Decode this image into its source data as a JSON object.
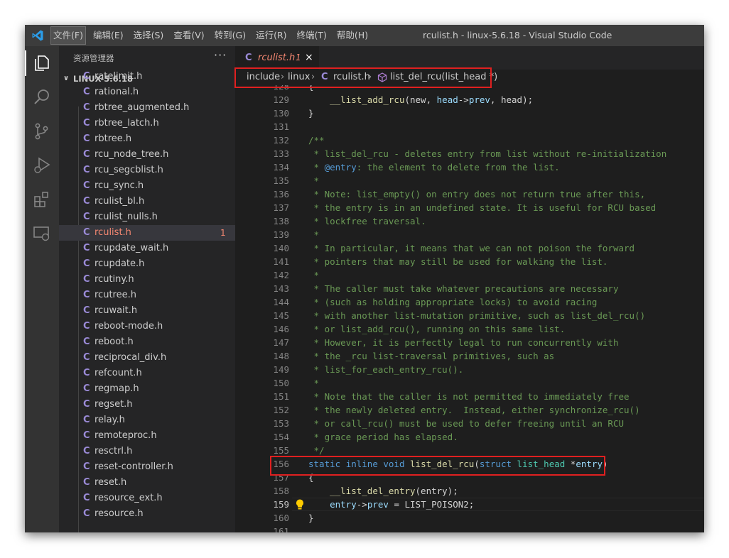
{
  "window": {
    "title": "rculist.h - linux-5.6.18 - Visual Studio Code"
  },
  "menu": [
    {
      "label": "文件(F)",
      "active": true
    },
    {
      "label": "编辑(E)",
      "active": false
    },
    {
      "label": "选择(S)",
      "active": false
    },
    {
      "label": "查看(V)",
      "active": false
    },
    {
      "label": "转到(G)",
      "active": false
    },
    {
      "label": "运行(R)",
      "active": false
    },
    {
      "label": "终端(T)",
      "active": false
    },
    {
      "label": "帮助(H)",
      "active": false
    }
  ],
  "activity_bar": [
    "explorer-icon",
    "search-icon",
    "source-control-icon",
    "run-debug-icon",
    "extensions-icon",
    "remote-explorer-icon"
  ],
  "sidebar": {
    "header": "资源管理器",
    "more": "···",
    "folder": "LINUX-5.6.18",
    "file_icon": "C",
    "files": [
      {
        "name": "ratelimit.h"
      },
      {
        "name": "rational.h"
      },
      {
        "name": "rbtree_augmented.h"
      },
      {
        "name": "rbtree_latch.h"
      },
      {
        "name": "rbtree.h"
      },
      {
        "name": "rcu_node_tree.h"
      },
      {
        "name": "rcu_segcblist.h"
      },
      {
        "name": "rcu_sync.h"
      },
      {
        "name": "rculist_bl.h"
      },
      {
        "name": "rculist_nulls.h"
      },
      {
        "name": "rculist.h",
        "selected": true,
        "badge": "1"
      },
      {
        "name": "rcupdate_wait.h"
      },
      {
        "name": "rcupdate.h"
      },
      {
        "name": "rcutiny.h"
      },
      {
        "name": "rcutree.h"
      },
      {
        "name": "rcuwait.h"
      },
      {
        "name": "reboot-mode.h"
      },
      {
        "name": "reboot.h"
      },
      {
        "name": "reciprocal_div.h"
      },
      {
        "name": "refcount.h"
      },
      {
        "name": "regmap.h"
      },
      {
        "name": "regset.h"
      },
      {
        "name": "relay.h"
      },
      {
        "name": "remoteproc.h"
      },
      {
        "name": "resctrl.h"
      },
      {
        "name": "reset-controller.h"
      },
      {
        "name": "reset.h"
      },
      {
        "name": "resource_ext.h"
      },
      {
        "name": "resource.h"
      }
    ]
  },
  "tab": {
    "icon": "C",
    "name": "rculist.h",
    "badge": "1",
    "close": "×"
  },
  "breadcrumb": {
    "items": [
      "include",
      "linux",
      "rculist.h",
      "list_del_rcu(list_head *)"
    ],
    "file_icon": "C",
    "separator": "›"
  },
  "code_lines": [
    {
      "n": "128",
      "tokens": [
        [
          "p",
          "{"
        ]
      ]
    },
    {
      "n": "129",
      "tokens": [
        [
          "p",
          "    "
        ],
        [
          "fn",
          "__list_add_rcu"
        ],
        [
          "p",
          "("
        ],
        [
          "p",
          "new, "
        ],
        [
          "var",
          "head"
        ],
        [
          "p",
          "->"
        ],
        [
          "var",
          "prev"
        ],
        [
          "p",
          ", head);"
        ]
      ]
    },
    {
      "n": "130",
      "tokens": [
        [
          "p",
          "}"
        ]
      ]
    },
    {
      "n": "131",
      "tokens": []
    },
    {
      "n": "132",
      "tokens": [
        [
          "cm",
          "/**"
        ]
      ]
    },
    {
      "n": "133",
      "tokens": [
        [
          "cm",
          " * list_del_rcu - deletes entry from list without re-initialization"
        ]
      ]
    },
    {
      "n": "134",
      "tokens": [
        [
          "cm",
          " * "
        ],
        [
          "doc",
          "@entry"
        ],
        [
          "cm",
          ": the element to delete from the list."
        ]
      ]
    },
    {
      "n": "135",
      "tokens": [
        [
          "cm",
          " *"
        ]
      ]
    },
    {
      "n": "136",
      "tokens": [
        [
          "cm",
          " * Note: list_empty() on entry does not return true after this,"
        ]
      ]
    },
    {
      "n": "137",
      "tokens": [
        [
          "cm",
          " * the entry is in an undefined state. It is useful for RCU based"
        ]
      ]
    },
    {
      "n": "138",
      "tokens": [
        [
          "cm",
          " * lockfree traversal."
        ]
      ]
    },
    {
      "n": "139",
      "tokens": [
        [
          "cm",
          " *"
        ]
      ]
    },
    {
      "n": "140",
      "tokens": [
        [
          "cm",
          " * In particular, it means that we can not poison the forward"
        ]
      ]
    },
    {
      "n": "141",
      "tokens": [
        [
          "cm",
          " * pointers that may still be used for walking the list."
        ]
      ]
    },
    {
      "n": "142",
      "tokens": [
        [
          "cm",
          " *"
        ]
      ]
    },
    {
      "n": "143",
      "tokens": [
        [
          "cm",
          " * The caller must take whatever precautions are necessary"
        ]
      ]
    },
    {
      "n": "144",
      "tokens": [
        [
          "cm",
          " * (such as holding appropriate locks) to avoid racing"
        ]
      ]
    },
    {
      "n": "145",
      "tokens": [
        [
          "cm",
          " * with another list-mutation primitive, such as list_del_rcu()"
        ]
      ]
    },
    {
      "n": "146",
      "tokens": [
        [
          "cm",
          " * or list_add_rcu(), running on this same list."
        ]
      ]
    },
    {
      "n": "147",
      "tokens": [
        [
          "cm",
          " * However, it is perfectly legal to run concurrently with"
        ]
      ]
    },
    {
      "n": "148",
      "tokens": [
        [
          "cm",
          " * the _rcu list-traversal primitives, such as"
        ]
      ]
    },
    {
      "n": "149",
      "tokens": [
        [
          "cm",
          " * list_for_each_entry_rcu()."
        ]
      ]
    },
    {
      "n": "150",
      "tokens": [
        [
          "cm",
          " *"
        ]
      ]
    },
    {
      "n": "151",
      "tokens": [
        [
          "cm",
          " * Note that the caller is not permitted to immediately free"
        ]
      ]
    },
    {
      "n": "152",
      "tokens": [
        [
          "cm",
          " * the newly deleted entry.  Instead, either synchronize_rcu()"
        ]
      ]
    },
    {
      "n": "153",
      "tokens": [
        [
          "cm",
          " * or call_rcu() must be used to defer freeing until an RCU"
        ]
      ]
    },
    {
      "n": "154",
      "tokens": [
        [
          "cm",
          " * grace period has elapsed."
        ]
      ]
    },
    {
      "n": "155",
      "tokens": [
        [
          "cm",
          " */"
        ]
      ]
    },
    {
      "n": "156",
      "tokens": [
        [
          "kw",
          "static"
        ],
        [
          "p",
          " "
        ],
        [
          "kw",
          "inline"
        ],
        [
          "p",
          " "
        ],
        [
          "kw",
          "void"
        ],
        [
          "p",
          " "
        ],
        [
          "fn",
          "list_del_rcu"
        ],
        [
          "p",
          "("
        ],
        [
          "kw",
          "struct"
        ],
        [
          "p",
          " "
        ],
        [
          "tp",
          "list_head"
        ],
        [
          "p",
          " *"
        ],
        [
          "var",
          "entry"
        ],
        [
          "p",
          ")"
        ]
      ]
    },
    {
      "n": "157",
      "tokens": [
        [
          "p",
          "{"
        ]
      ]
    },
    {
      "n": "158",
      "tokens": [
        [
          "p",
          "    "
        ],
        [
          "fn",
          "__list_del_entry"
        ],
        [
          "p",
          "(entry);"
        ]
      ]
    },
    {
      "n": "159",
      "current": true,
      "bulb": true,
      "tokens": [
        [
          "p",
          "    "
        ],
        [
          "var",
          "entry"
        ],
        [
          "p",
          "->"
        ],
        [
          "var",
          "prev"
        ],
        [
          "p",
          " = LIST_POISON2;"
        ]
      ]
    },
    {
      "n": "160",
      "tokens": [
        [
          "p",
          "}"
        ]
      ]
    },
    {
      "n": "161",
      "tokens": []
    }
  ],
  "colors": {
    "accent_highlight_box": "#e02020",
    "selected_file_text": "#f48771",
    "c_file_icon": "#9b8bd8",
    "comment": "#6a9955",
    "keyword": "#569cd6"
  }
}
